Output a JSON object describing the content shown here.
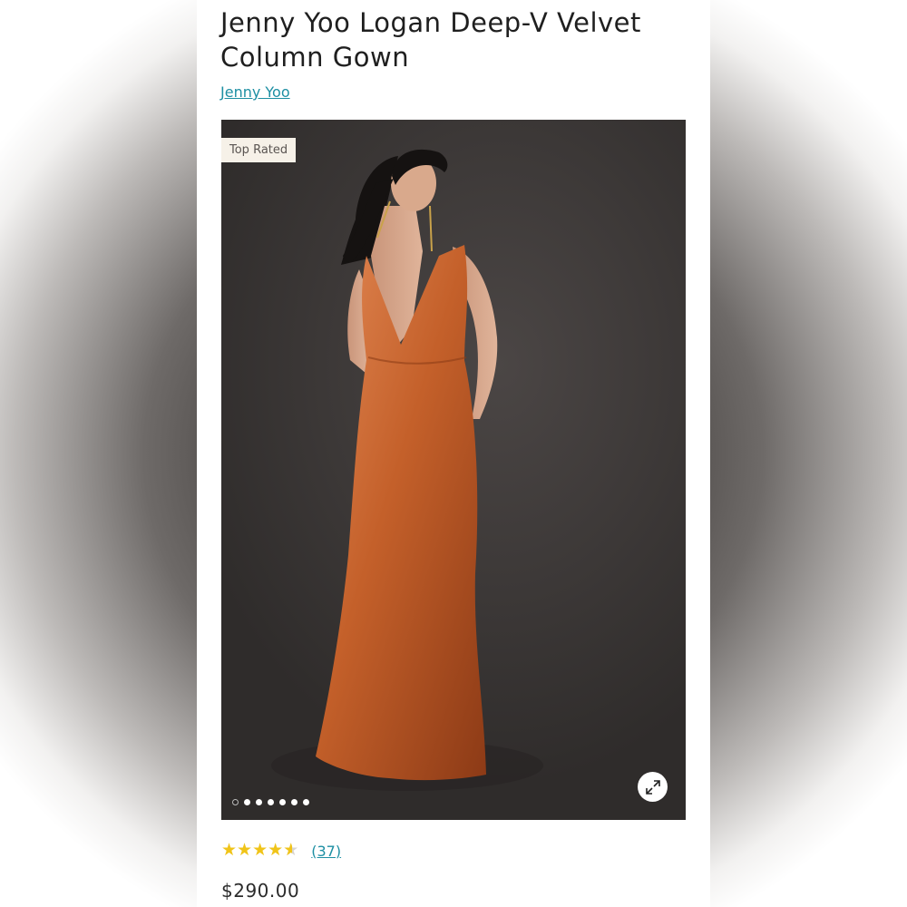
{
  "product": {
    "title": "Jenny Yoo Logan Deep-V Velvet Column Gown",
    "brand": "Jenny Yoo",
    "badge": "Top Rated",
    "rating": {
      "value": 4.5,
      "max": 5,
      "review_count_label": "(37)"
    },
    "price": "$290.00"
  },
  "gallery": {
    "slide_count": 7,
    "active_slide": 1,
    "expand_icon": "expand-arrows-icon"
  },
  "colors": {
    "link": "#1d8fa3",
    "star": "#f0c419",
    "dress": "#b8521f",
    "backdrop": "#3c3837"
  }
}
